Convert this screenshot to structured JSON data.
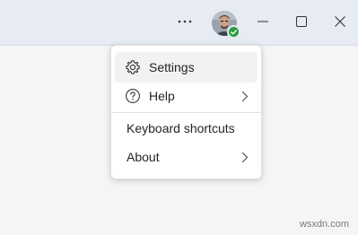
{
  "titlebar": {
    "more_icon": "more-horizontal-icon",
    "avatar_icon": "user-avatar",
    "presence": "available",
    "presence_color": "#2a9d3a",
    "minimize_icon": "minimize-icon",
    "maximize_icon": "maximize-icon",
    "close_icon": "close-icon"
  },
  "menu": {
    "items": [
      {
        "label": "Settings",
        "icon": "gear-icon",
        "submenu": false,
        "hovered": true
      },
      {
        "label": "Help",
        "icon": "help-circle-icon",
        "submenu": true,
        "hovered": false
      },
      {
        "label": "Keyboard shortcuts",
        "icon": "",
        "submenu": false,
        "hovered": false
      },
      {
        "label": "About",
        "icon": "",
        "submenu": true,
        "hovered": false
      }
    ]
  },
  "watermark": "wsxdn.com"
}
